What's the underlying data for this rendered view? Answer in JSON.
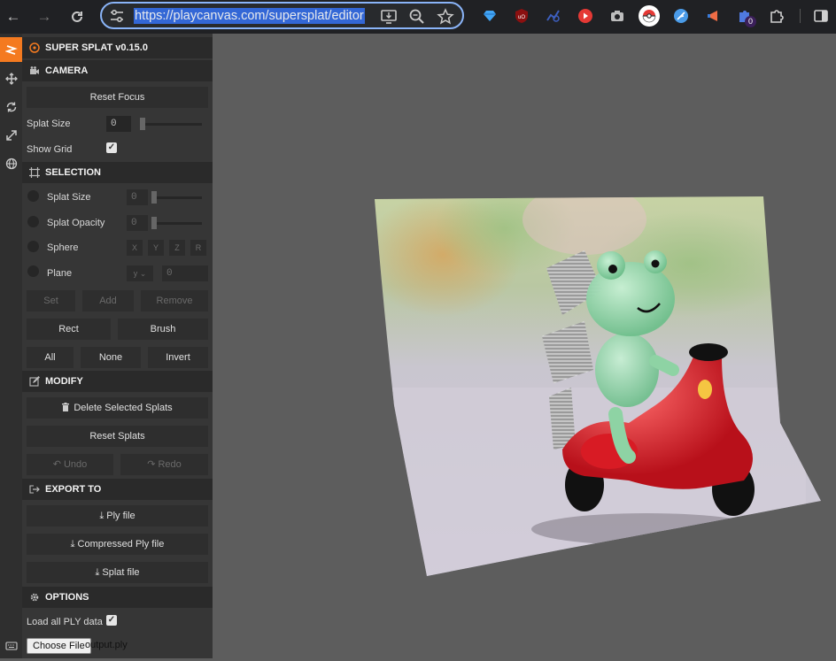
{
  "browser": {
    "url": "https://playcanvas.com/supersplat/editor",
    "extension_badge": "0"
  },
  "app": {
    "title": "SUPER SPLAT v0.15.0"
  },
  "camera": {
    "header": "CAMERA",
    "reset_focus": "Reset Focus",
    "splat_size_label": "Splat Size",
    "splat_size_value": "0",
    "show_grid_label": "Show Grid",
    "show_grid_checked": true
  },
  "selection": {
    "header": "SELECTION",
    "splat_size_label": "Splat Size",
    "splat_size_value": "0",
    "splat_opacity_label": "Splat Opacity",
    "splat_opacity_value": "0",
    "sphere_label": "Sphere",
    "sphere_axes": [
      "X",
      "Y",
      "Z",
      "R"
    ],
    "plane_label": "Plane",
    "plane_axis": "y",
    "plane_value": "0",
    "set": "Set",
    "add": "Add",
    "remove": "Remove",
    "rect": "Rect",
    "brush": "Brush",
    "all": "All",
    "none": "None",
    "invert": "Invert"
  },
  "modify": {
    "header": "MODIFY",
    "delete_selected": "Delete Selected Splats",
    "reset_splats": "Reset Splats",
    "undo": "Undo",
    "redo": "Redo"
  },
  "export": {
    "header": "EXPORT TO",
    "ply": "Ply file",
    "compressed_ply": "Compressed Ply file",
    "splat": "Splat file"
  },
  "options": {
    "header": "OPTIONS",
    "load_all_label": "Load all PLY data",
    "load_all_checked": true,
    "choose_file": "Choose File",
    "file_name": "output.ply"
  },
  "colors": {
    "accent": "#f47a20",
    "panel": "#363636",
    "header": "#2a2a2a",
    "viewport": "#5d5d5d"
  }
}
